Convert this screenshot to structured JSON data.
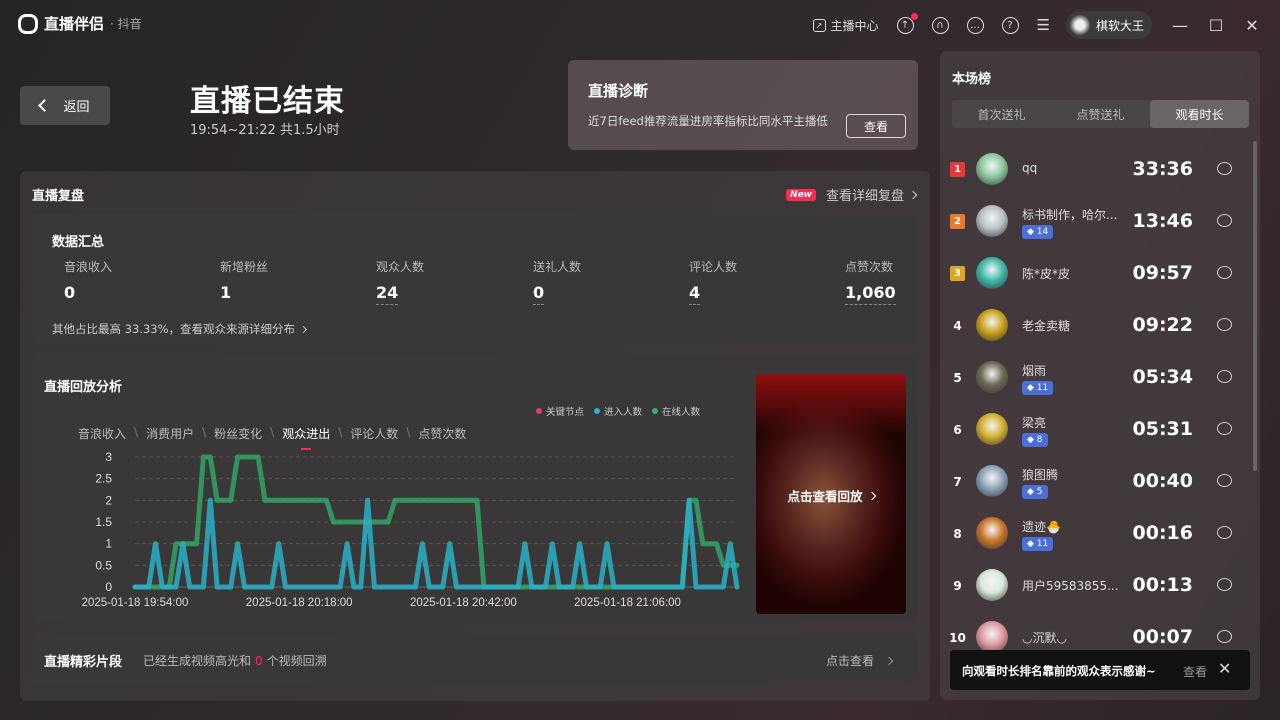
{
  "app": {
    "name": "直播伴侣",
    "sub": "· 抖音"
  },
  "titlebar": {
    "anchor_center": "主播中心",
    "user_name": "棋软大王"
  },
  "header": {
    "back_label": "返回",
    "title": "直播已结束",
    "time": "19:54~21:22 共1.5小时",
    "diagnosis": {
      "title": "直播诊断",
      "text": "近7日feed推荐流量进房率指标比同水平主播低",
      "button": "查看"
    }
  },
  "replay": {
    "title": "直播复盘",
    "new_badge": "New",
    "detail_link": "查看详细复盘",
    "summary": {
      "title": "数据汇总",
      "stats": [
        {
          "label": "音浪收入",
          "value": "0"
        },
        {
          "label": "新增粉丝",
          "value": "1"
        },
        {
          "label": "观众人数",
          "value": "24"
        },
        {
          "label": "送礼人数",
          "value": "0"
        },
        {
          "label": "评论人数",
          "value": "4"
        },
        {
          "label": "点赞次数",
          "value": "1,060"
        }
      ],
      "note": "其他占比最高 33.33%，查看观众来源详细分布"
    },
    "analysis": {
      "title": "直播回放分析",
      "legend": [
        "关键节点",
        "进入人数",
        "在线人数"
      ],
      "tabs": [
        "音浪收入",
        "消费用户",
        "粉丝变化",
        "观众进出",
        "评论人数",
        "点赞次数"
      ],
      "active_tab": 3,
      "video_label": "点击查看回放"
    },
    "highlights": {
      "title": "直播精彩片段",
      "text_before": "已经生成视频高光和",
      "count": "0",
      "text_after": "个视频回溯",
      "link": "点击查看"
    }
  },
  "chart_data": {
    "type": "line",
    "title": "",
    "xlabel": "",
    "ylabel": "",
    "ylim": [
      0,
      3
    ],
    "yticks": [
      "0",
      "0.5",
      "1",
      "1.5",
      "2",
      "2.5",
      "3"
    ],
    "xticks": [
      "2025-01-18 19:54:00",
      "2025-01-18 20:18:00",
      "2025-01-18 20:42:00",
      "2025-01-18 21:06:00"
    ],
    "grid": true,
    "legend_position": "top-right",
    "x_start": "2025-01-18 19:54:00",
    "x_end": "2025-01-18 21:22:00",
    "series": [
      {
        "name": "在线人数",
        "color": "#2fb36a",
        "x": [
          "2025-01-18 19:54:00",
          "2025-01-18 19:59:00",
          "2025-01-18 20:00:00",
          "2025-01-18 20:03:00",
          "2025-01-18 20:04:00",
          "2025-01-18 20:05:00",
          "2025-01-18 20:06:00",
          "2025-01-18 20:08:00",
          "2025-01-18 20:09:00",
          "2025-01-18 20:12:00",
          "2025-01-18 20:13:00",
          "2025-01-18 20:22:00",
          "2025-01-18 20:23:00",
          "2025-01-18 20:31:00",
          "2025-01-18 20:32:00",
          "2025-01-18 20:44:00",
          "2025-01-18 20:45:00",
          "2025-01-18 21:14:00",
          "2025-01-18 21:15:00",
          "2025-01-18 21:16:00",
          "2025-01-18 21:17:00",
          "2025-01-18 21:19:00",
          "2025-01-18 21:20:00",
          "2025-01-18 21:22:00"
        ],
        "values": [
          0,
          0,
          1,
          1,
          3,
          3,
          2,
          2,
          3,
          3,
          2,
          2,
          1.5,
          1.5,
          2,
          2,
          0,
          0,
          2,
          2,
          1,
          1,
          0.5,
          0.5
        ]
      },
      {
        "name": "进入人数",
        "color": "#2ab0c8",
        "x": [
          "2025-01-18 19:54:00",
          "2025-01-18 19:56:00",
          "2025-01-18 19:57:00",
          "2025-01-18 19:58:00",
          "2025-01-18 20:00:00",
          "2025-01-18 20:01:00",
          "2025-01-18 20:02:00",
          "2025-01-18 20:04:00",
          "2025-01-18 20:05:00",
          "2025-01-18 20:06:00",
          "2025-01-18 20:08:00",
          "2025-01-18 20:09:00",
          "2025-01-18 20:10:00",
          "2025-01-18 20:14:00",
          "2025-01-18 20:15:00",
          "2025-01-18 20:16:00",
          "2025-01-18 20:24:00",
          "2025-01-18 20:25:00",
          "2025-01-18 20:26:00",
          "2025-01-18 20:27:00",
          "2025-01-18 20:28:00",
          "2025-01-18 20:29:00",
          "2025-01-18 20:35:00",
          "2025-01-18 20:36:00",
          "2025-01-18 20:37:00",
          "2025-01-18 20:39:00",
          "2025-01-18 20:40:00",
          "2025-01-18 20:41:00",
          "2025-01-18 20:50:00",
          "2025-01-18 20:51:00",
          "2025-01-18 20:52:00",
          "2025-01-18 20:54:00",
          "2025-01-18 20:55:00",
          "2025-01-18 20:56:00",
          "2025-01-18 20:58:00",
          "2025-01-18 20:59:00",
          "2025-01-18 21:00:00",
          "2025-01-18 21:02:00",
          "2025-01-18 21:03:00",
          "2025-01-18 21:04:00",
          "2025-01-18 21:14:00",
          "2025-01-18 21:15:00",
          "2025-01-18 21:16:00",
          "2025-01-18 21:20:00",
          "2025-01-18 21:21:00",
          "2025-01-18 21:22:00"
        ],
        "values": [
          0,
          0,
          1,
          0,
          0,
          1,
          0,
          0,
          2,
          0,
          0,
          1,
          0,
          0,
          1,
          0,
          0,
          1,
          0,
          0,
          2,
          0,
          0,
          1,
          0,
          0,
          1,
          0,
          0,
          1,
          0,
          0,
          1,
          0,
          0,
          1,
          0,
          0,
          1,
          0,
          0,
          2,
          0,
          0,
          1,
          0
        ]
      }
    ]
  },
  "ranking": {
    "title": "本场榜",
    "tabs": [
      "首次送礼",
      "点赞送礼",
      "观看时长"
    ],
    "active_tab": 2,
    "rows": [
      {
        "rank": "1",
        "name": "qq",
        "badge": "",
        "time": "33:36",
        "avatar": "#8bc9a0"
      },
      {
        "rank": "2",
        "name": "标书制作，哈尔...",
        "badge": "14",
        "time": "13:46",
        "avatar": "#b9c2c8"
      },
      {
        "rank": "3",
        "name": "陈*皮*皮",
        "badge": "",
        "time": "09:57",
        "avatar": "#3fb8a8"
      },
      {
        "rank": "4",
        "name": "老金卖糖",
        "badge": "",
        "time": "09:22",
        "avatar": "#c9a21c"
      },
      {
        "rank": "5",
        "name": "烟雨",
        "badge": "11",
        "time": "05:34",
        "avatar": "#6b6a55"
      },
      {
        "rank": "6",
        "name": "梁亮",
        "badge": "8",
        "time": "05:31",
        "avatar": "#d4b030"
      },
      {
        "rank": "7",
        "name": "狼图腾",
        "badge": "5",
        "time": "00:40",
        "avatar": "#8da3b8"
      },
      {
        "rank": "8",
        "name": "遗迹🐣",
        "badge": "11",
        "time": "00:16",
        "avatar": "#c8762a"
      },
      {
        "rank": "9",
        "name": "用户59583855...",
        "badge": "",
        "time": "00:13",
        "avatar": "#d8e8d8"
      },
      {
        "rank": "10",
        "name": "◡沉默◡",
        "badge": "",
        "time": "00:07",
        "avatar": "#e09aa0"
      }
    ]
  },
  "toast": {
    "text": "向观看时长排名靠前的观众表示感谢~",
    "link": "查看",
    "close": "✕"
  }
}
